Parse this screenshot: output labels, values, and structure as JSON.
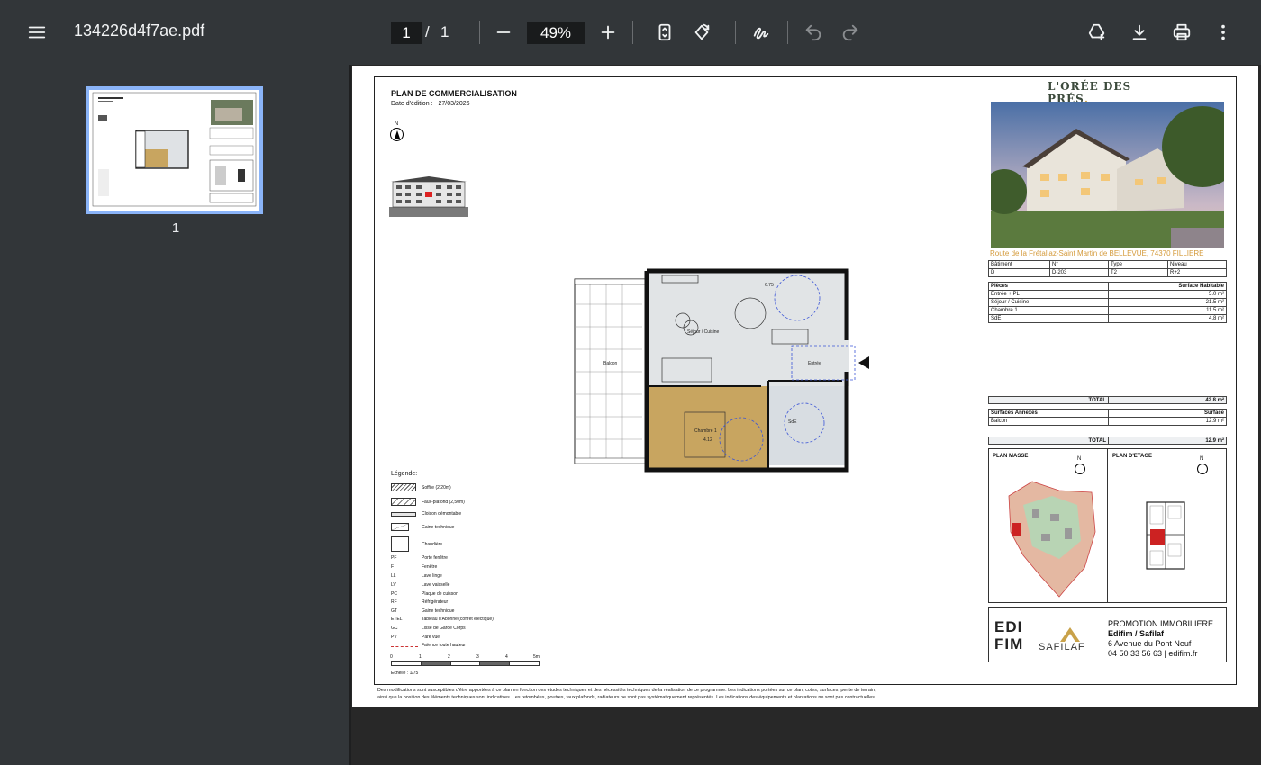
{
  "toolbar": {
    "file_name": "134226d4f7ae.pdf",
    "current_page": "1",
    "page_separator": "/",
    "total_pages": "1",
    "zoom": "49%",
    "icons": [
      "menu-icon",
      "zoom-out-icon",
      "zoom-in-icon",
      "fit-page-icon",
      "rotate-icon",
      "draw-icon",
      "undo-icon",
      "redo-icon",
      "add-to-drive-icon",
      "download-icon",
      "print-icon",
      "more-vert-icon"
    ]
  },
  "sidebar": {
    "thumbnails": [
      {
        "label": "1"
      }
    ]
  },
  "document": {
    "title": "PLAN DE COMMERCIALISATION",
    "date_label": "Date d'édition :",
    "date_value": "27/03/2026",
    "north_label": "N",
    "brand": "L'ORÉE DES PRÉS",
    "brand_dot": ".",
    "address": "Route de la Frétallaz-Saint Martin de BELLEVUE, 74370 FILLIERE",
    "plan_labels": {
      "sejour": "Séjour / Cuisine",
      "entree": "Entrée",
      "chambre": "Chambre 1",
      "chambre_dim": "4.12",
      "sde": "SdE",
      "balcon": "Balcon",
      "dim_top": "6.75"
    },
    "info_table": {
      "headers": [
        "Bâtiment",
        "N°",
        "Type",
        "Niveau"
      ],
      "values": [
        "D",
        "D-203",
        "T2",
        "R+2"
      ]
    },
    "rooms_table": {
      "header_left": "Pièces",
      "header_right": "Surface Habitable",
      "rows": [
        {
          "name": "Entrée + PL",
          "surface": "5.0 m²"
        },
        {
          "name": "Séjour / Cuisine",
          "surface": "21.5 m²"
        },
        {
          "name": "Chambre 1",
          "surface": "11.5 m²"
        },
        {
          "name": "SdE",
          "surface": "4.8 m²"
        }
      ]
    },
    "total_label": "TOTAL",
    "total_habitable": "42.8 m²",
    "annexes_table": {
      "header_left": "Surfaces Annexes",
      "header_right": "Surface",
      "rows": [
        {
          "name": "Balcon",
          "surface": "12.9 m²"
        }
      ]
    },
    "total_annexes": "12.9 m²",
    "plan_masse_label": "PLAN MASSE",
    "plan_etage_label": "PLAN D'ETAGE",
    "promo": {
      "logo_edifim": "EDI FIM",
      "logo_safilaf": "SAFILAF",
      "line1": "PROMOTION IMMOBILIERE",
      "line2": "Edifim / Safilaf",
      "line3": "6 Avenue du Pont Neuf",
      "line4": "04 50 33 56 63 | edifim.fr"
    },
    "legend": {
      "title": "Légende:",
      "items": [
        {
          "abbr": "",
          "label": "Soffite (2,20m)"
        },
        {
          "abbr": "",
          "label": "Faux-plafond (2,50m)"
        },
        {
          "abbr": "",
          "label": "Cloison démontable"
        },
        {
          "abbr": "",
          "label": "Gaine technique"
        },
        {
          "abbr": "",
          "label": "Chaudière"
        },
        {
          "abbr": "PF",
          "label": "Porte fenêtre"
        },
        {
          "abbr": "F",
          "label": "Fenêtre"
        },
        {
          "abbr": "LL",
          "label": "Lave linge"
        },
        {
          "abbr": "LV",
          "label": "Lave vaisselle"
        },
        {
          "abbr": "PC",
          "label": "Plaque de cuisson"
        },
        {
          "abbr": "RF",
          "label": "Réfrigérateur"
        },
        {
          "abbr": "GT",
          "label": "Gaine technique"
        },
        {
          "abbr": "ETEL",
          "label": "Tableau d'Abonné (coffret électique)"
        },
        {
          "abbr": "GC",
          "label": "Lisse de Garde Corps"
        },
        {
          "abbr": "PV",
          "label": "Pare vue"
        },
        {
          "abbr": "",
          "label": "Faïence toute hauteur"
        }
      ]
    },
    "scale": {
      "ticks": [
        "0",
        "1",
        "2",
        "3",
        "4",
        "5m"
      ],
      "label": "Echelle : 1/75"
    },
    "disclaimer_1": "Des modifications sont susceptibles d'être apportées à ce plan en fonction des études techniques et des nécessités techniques de la réalisation de ce programme.   Les indications portées sur ce plan, cotes, surfaces, pente de terrain,",
    "disclaimer_2": "ainsi que la position des éléments techniques sont indicatives.  Les retombées, poutres, faux plafonds, radiateurs ne sont pas systématiquement représentés. Les indications des équipements et plantations ne sont pas contractuelles."
  },
  "colors": {
    "toolbar_bg": "#323639",
    "viewer_bg": "#282828",
    "thumb_highlight": "#8ab4f8",
    "bedroom_fill": "#c8a560",
    "living_fill": "#e1e4e6",
    "brand_gold": "#c9a24a",
    "address_orange": "#d49a3a"
  }
}
